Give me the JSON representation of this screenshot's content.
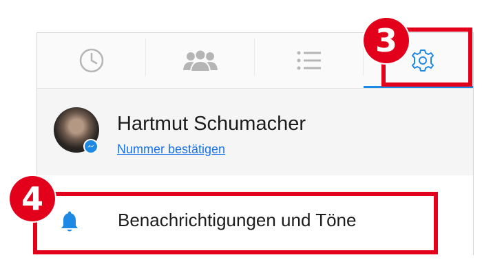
{
  "tabs": [
    {
      "icon": "clock-icon"
    },
    {
      "icon": "people-icon"
    },
    {
      "icon": "list-icon"
    },
    {
      "icon": "gear-icon",
      "active": true
    }
  ],
  "profile": {
    "name": "Hartmut Schumacher",
    "link": "Nummer bestätigen",
    "badge_icon": "messenger-icon"
  },
  "settings_row": {
    "icon": "bell-icon",
    "label": "Benachrichtigungen und Töne"
  },
  "annotations": {
    "step_3": "3",
    "step_4": "4"
  },
  "colors": {
    "accent": "#1e88e5",
    "link": "#1a73e8",
    "highlight": "#e3001b",
    "tab_icon": "#b5b5b5"
  }
}
